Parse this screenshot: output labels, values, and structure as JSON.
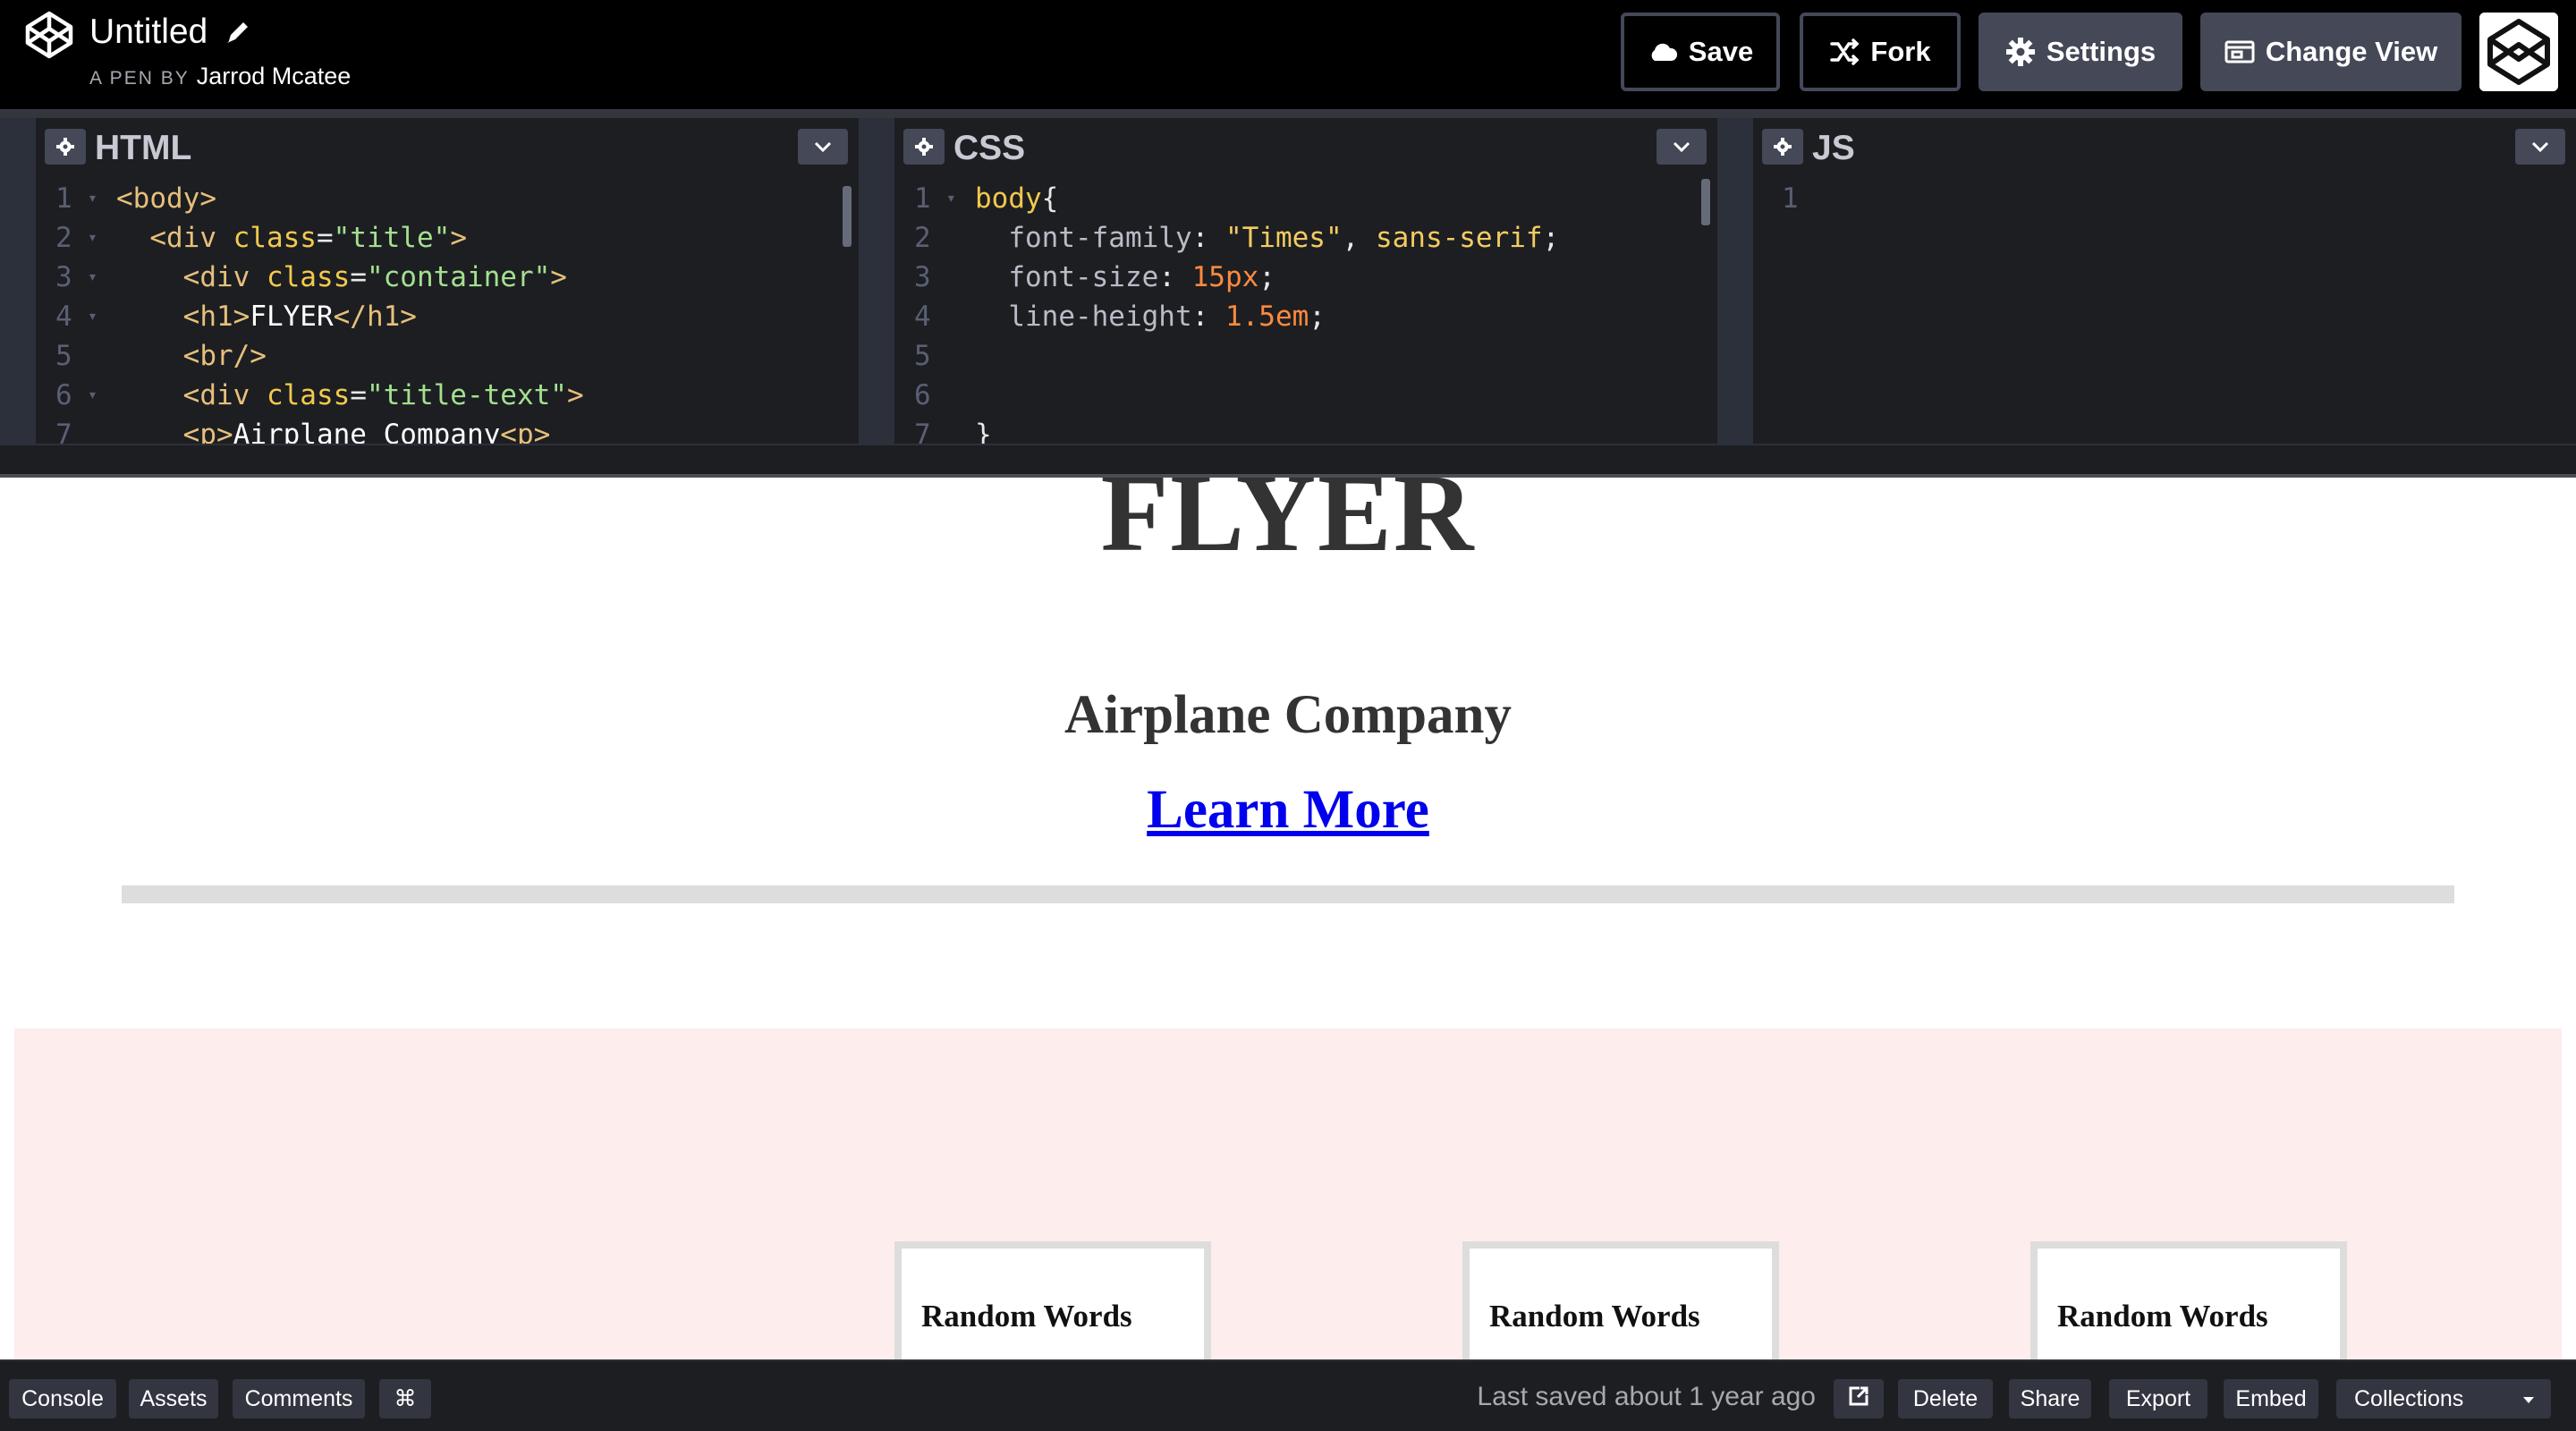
{
  "header": {
    "pen_title": "Untitled",
    "pen_by_label": "A PEN BY",
    "author": "Jarrod Mcatee",
    "buttons": {
      "save": "Save",
      "fork": "Fork",
      "settings": "Settings",
      "change_view": "Change View"
    },
    "icons": [
      "codepen-logo-icon",
      "pencil-edit-icon",
      "cloud-icon",
      "fork-icon",
      "gear-icon",
      "change-view-icon",
      "user-avatar"
    ]
  },
  "editors": {
    "html": {
      "title": "HTML",
      "lines": [
        {
          "n": "1",
          "fold": true
        },
        {
          "n": "2",
          "fold": true
        },
        {
          "n": "3",
          "fold": true
        },
        {
          "n": "4",
          "fold": true
        },
        {
          "n": "5",
          "fold": false
        },
        {
          "n": "6",
          "fold": true
        },
        {
          "n": "7",
          "fold": false
        }
      ],
      "code": {
        "l1_tag": "<body>",
        "l2_open": "<div ",
        "l2_attr": "class",
        "l2_eq": "=",
        "l2_val": "\"title\"",
        "l2_close": ">",
        "l3_open": "<div ",
        "l3_attr": "class",
        "l3_eq": "=",
        "l3_val": "\"container\"",
        "l3_close": ">",
        "l4_open": "<h1>",
        "l4_text": "FLYER",
        "l4_close": "</h1>",
        "l5_tag": "<br/>",
        "l6_open": "<div ",
        "l6_attr": "class",
        "l6_eq": "=",
        "l6_val": "\"title-text\"",
        "l6_close": ">",
        "l7_open": "<p>",
        "l7_text": "Airplane Company",
        "l7_close": "<p>"
      }
    },
    "css": {
      "title": "CSS",
      "lines": [
        {
          "n": "1",
          "fold": true
        },
        {
          "n": "2",
          "fold": false
        },
        {
          "n": "3",
          "fold": false
        },
        {
          "n": "4",
          "fold": false
        },
        {
          "n": "5",
          "fold": false
        },
        {
          "n": "6",
          "fold": false
        },
        {
          "n": "7",
          "fold": false
        }
      ],
      "code": {
        "l1_sel": "body",
        "l1_brace": "{",
        "l2_prop": "font-family",
        "l2_colon": ": ",
        "l2_str": "\"Times\"",
        "l2_comma": ", ",
        "l2_val": "sans-serif",
        "l2_semi": ";",
        "l3_prop": "font-size",
        "l3_colon": ": ",
        "l3_num": "15px",
        "l3_semi": ";",
        "l4_prop": "line-height",
        "l4_colon": ": ",
        "l4_num": "1.5em",
        "l4_semi": ";",
        "l7_brace": "}"
      }
    },
    "js": {
      "title": "JS",
      "lines": [
        {
          "n": "1",
          "fold": false
        }
      ]
    }
  },
  "preview": {
    "heading": "FLYER",
    "subtitle": "Airplane Company",
    "link": "Learn More",
    "cards": [
      {
        "title": "Random Words"
      },
      {
        "title": "Random Words"
      },
      {
        "title": "Random Words"
      }
    ]
  },
  "footer": {
    "buttons": {
      "console": "Console",
      "assets": "Assets",
      "comments": "Comments",
      "shortcuts": "⌘",
      "delete": "Delete",
      "share": "Share",
      "export": "Export",
      "embed": "Embed",
      "collections": "Collections"
    },
    "last_saved": "Last saved about 1 year ago"
  },
  "colors": {
    "header_bg": "#000000",
    "editor_bg": "#1d1e22",
    "button_bg": "#444857",
    "pink_section": "#fdeded",
    "link": "#0000ee"
  }
}
